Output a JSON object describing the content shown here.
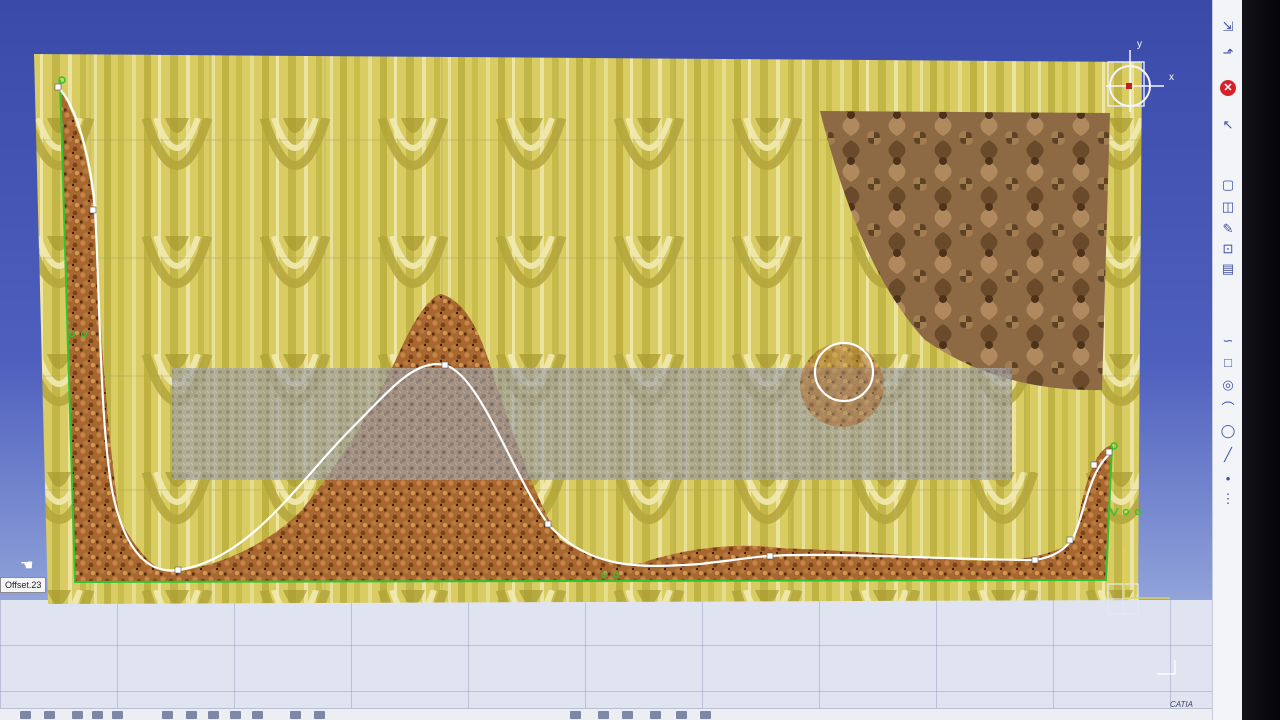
{
  "feature_label": "Offset.23",
  "axis_labels": {
    "y": "y",
    "x": "x"
  },
  "logo_text": "CATIA",
  "right_toolbar": [
    {
      "name": "normal-view-icon",
      "glyph": "⇲"
    },
    {
      "name": "export-icon",
      "glyph": "⬏"
    },
    {
      "name": "exit-workbench-icon",
      "glyph": "✕"
    },
    {
      "name": "select-arrow-icon",
      "glyph": "↖"
    },
    {
      "name": "profile-icon",
      "glyph": "▢"
    },
    {
      "name": "cut-by-plane-icon",
      "glyph": "◫"
    },
    {
      "name": "pencil-icon",
      "glyph": "✎"
    },
    {
      "name": "constraint-icon",
      "glyph": "⊡"
    },
    {
      "name": "layers-icon",
      "glyph": "▤"
    },
    {
      "name": "spline-tool-icon",
      "glyph": "∽"
    },
    {
      "name": "rectangle-tool-icon",
      "glyph": "□"
    },
    {
      "name": "circle-tool-icon",
      "glyph": "◎"
    },
    {
      "name": "conic-tool-icon",
      "glyph": "⌒"
    },
    {
      "name": "ellipse-tool-icon",
      "glyph": "◯"
    },
    {
      "name": "line-tool-icon",
      "glyph": "╱"
    },
    {
      "name": "point-tool-icon",
      "glyph": "•"
    },
    {
      "name": "axis-tool-icon",
      "glyph": "⋮"
    }
  ],
  "colors": {
    "background_blue": "#4a5bb8",
    "wood_yellow": "#cfc35a",
    "cork_brown": "#a86a33",
    "spline_white": "#ffffff",
    "constraint_green": "#2ec52e",
    "circle_outline": "#ffffff",
    "close_red": "#d7202a"
  }
}
